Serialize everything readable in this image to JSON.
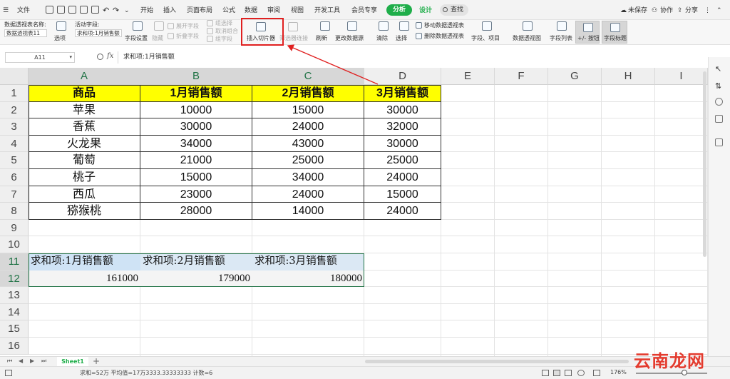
{
  "colors": {
    "accent_green": "#1fae4a",
    "header_yellow": "#ffff00",
    "pivot_blue": "#dbe8f4",
    "highlight_red": "#e02020",
    "watermark_red": "#e33b2e"
  },
  "menubar": {
    "file": "文件",
    "tabs": [
      "开始",
      "插入",
      "页面布局",
      "公式",
      "数据",
      "审阅",
      "视图",
      "开发工具",
      "会员专享",
      "分析",
      "设计"
    ],
    "active_tab": "分析",
    "search": "查找",
    "unsaved": "未保存",
    "collab": "协作",
    "share": "分享"
  },
  "ribbon": {
    "pivot_name_label": "数据透视表名称:",
    "pivot_name_value": "数据透视表11",
    "options": "选项",
    "active_field_label": "活动字段:",
    "active_field_value": "求和项:1月销售额",
    "field_settings": "字段设置",
    "hide": "隐藏",
    "expand_field": "展开字段",
    "collapse_field": "折叠字段",
    "group_select": "组选择",
    "cancel_group": "取消组合",
    "group_field": "组字段",
    "insert_slicer": "插入切片器",
    "filter_connect": "筛选器连接",
    "refresh": "刷新",
    "change_source": "更改数据源",
    "clear": "清除",
    "select": "选择",
    "move_pivot": "移动数据透视表",
    "delete_pivot": "删除数据透视表",
    "fields_items": "字段、项目",
    "pivot_chart": "数据透视图",
    "field_list": "字段列表",
    "plus_minus": "+/- 按钮",
    "field_headers": "字段标题"
  },
  "formula_bar": {
    "name_box": "A11",
    "fx": "fx",
    "formula": "求和项:1月销售额"
  },
  "sheet": {
    "columns": [
      "A",
      "B",
      "C",
      "D",
      "E",
      "F",
      "G",
      "H",
      "I"
    ],
    "rows": [
      "1",
      "2",
      "3",
      "4",
      "5",
      "6",
      "7",
      "8",
      "9",
      "10",
      "11",
      "12",
      "13",
      "14",
      "15",
      "16"
    ],
    "table_header": [
      "商品",
      "1月销售额",
      "2月销售额",
      "3月销售额"
    ],
    "table_rows": [
      [
        "苹果",
        "10000",
        "15000",
        "30000"
      ],
      [
        "香蕉",
        "30000",
        "24000",
        "32000"
      ],
      [
        "火龙果",
        "34000",
        "43000",
        "30000"
      ],
      [
        "葡萄",
        "21000",
        "25000",
        "25000"
      ],
      [
        "桃子",
        "15000",
        "34000",
        "24000"
      ],
      [
        "西瓜",
        "23000",
        "24000",
        "15000"
      ],
      [
        "猕猴桃",
        "28000",
        "14000",
        "24000"
      ]
    ],
    "pivot_headers": [
      "求和项:1月销售额",
      "求和项:2月销售额",
      "求和项:3月销售额"
    ],
    "pivot_values": [
      "161000",
      "179000",
      "180000"
    ]
  },
  "tabs_bar": {
    "sheet_name": "Sheet1",
    "add": "+"
  },
  "status_bar": {
    "summary": "求和=52万  平均值=17万3333.33333333  计数=6",
    "zoom": "176%"
  },
  "watermark": "云南龙网"
}
